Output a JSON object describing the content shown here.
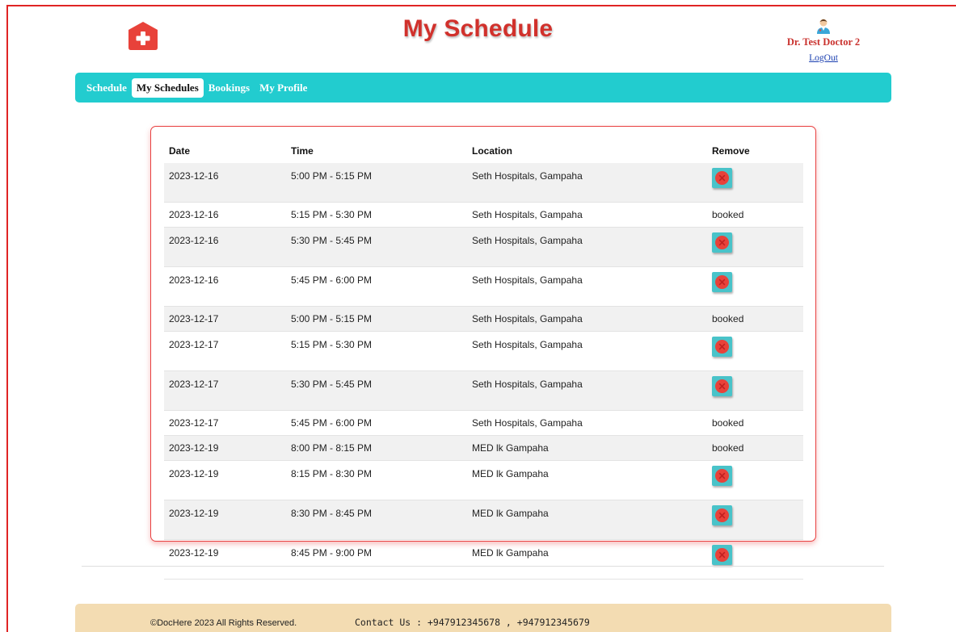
{
  "header": {
    "title": "My Schedule",
    "user_name": "Dr. Test Doctor 2",
    "logout_label": "LogOut"
  },
  "nav": {
    "items": [
      {
        "label": "Schedule",
        "active": false
      },
      {
        "label": "My Schedules",
        "active": true
      },
      {
        "label": "Bookings",
        "active": false
      },
      {
        "label": "My Profile",
        "active": false
      }
    ]
  },
  "table": {
    "headers": {
      "date": "Date",
      "time": "Time",
      "location": "Location",
      "remove": "Remove"
    },
    "rows": [
      {
        "date": "2023-12-16",
        "time": "5:00 PM - 5:15 PM",
        "location": "Seth Hospitals, Gampaha",
        "status": "remove"
      },
      {
        "date": "2023-12-16",
        "time": "5:15 PM - 5:30 PM",
        "location": "Seth Hospitals, Gampaha",
        "status": "booked"
      },
      {
        "date": "2023-12-16",
        "time": "5:30 PM - 5:45 PM",
        "location": "Seth Hospitals, Gampaha",
        "status": "remove"
      },
      {
        "date": "2023-12-16",
        "time": "5:45 PM - 6:00 PM",
        "location": "Seth Hospitals, Gampaha",
        "status": "remove"
      },
      {
        "date": "2023-12-17",
        "time": "5:00 PM - 5:15 PM",
        "location": "Seth Hospitals, Gampaha",
        "status": "booked"
      },
      {
        "date": "2023-12-17",
        "time": "5:15 PM - 5:30 PM",
        "location": "Seth Hospitals, Gampaha",
        "status": "remove"
      },
      {
        "date": "2023-12-17",
        "time": "5:30 PM - 5:45 PM",
        "location": "Seth Hospitals, Gampaha",
        "status": "remove"
      },
      {
        "date": "2023-12-17",
        "time": "5:45 PM - 6:00 PM",
        "location": "Seth Hospitals, Gampaha",
        "status": "booked"
      },
      {
        "date": "2023-12-19",
        "time": "8:00 PM - 8:15 PM",
        "location": "MED lk Gampaha",
        "status": "booked"
      },
      {
        "date": "2023-12-19",
        "time": "8:15 PM - 8:30 PM",
        "location": "MED lk Gampaha",
        "status": "remove"
      },
      {
        "date": "2023-12-19",
        "time": "8:30 PM - 8:45 PM",
        "location": "MED lk Gampaha",
        "status": "remove"
      },
      {
        "date": "2023-12-19",
        "time": "8:45 PM - 9:00 PM",
        "location": "MED lk Gampaha",
        "status": "remove"
      }
    ],
    "booked_label": "booked"
  },
  "footer": {
    "copyright": "©DocHere 2023 All Rights Reserved.",
    "contact": "Contact Us : +947912345678 , +947912345679"
  },
  "colors": {
    "brand_red": "#d1312c",
    "nav_teal": "#22cccf",
    "remove_button_bg": "#49c3c9",
    "remove_icon_red": "#e8423a",
    "footer_bg": "#f3dcb2"
  },
  "icons": {
    "logo": "medical-cross-icon",
    "avatar": "doctor-avatar-icon",
    "remove": "remove-x-circle-icon"
  }
}
